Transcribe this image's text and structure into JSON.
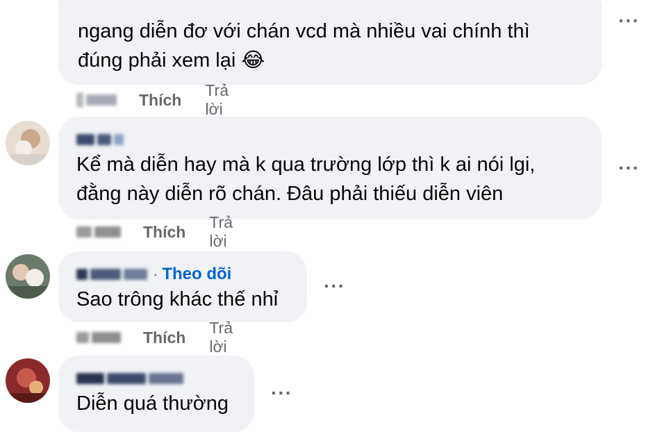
{
  "comments": [
    {
      "text": "ngang diễn đơ với chán vcd mà nhiều vai chính thì\nđúng phải xem lại",
      "emoji": "😂",
      "like_label": "Thích",
      "reply_label": "Trả lời",
      "more_label": "···"
    },
    {
      "text": "Kể mà diễn hay mà k qua trường lớp thì k ai nói lgi,\nđằng này diễn rõ chán. Đâu phải thiếu diễn viên",
      "like_label": "Thích",
      "reply_label": "Trả lời",
      "more_label": "···"
    },
    {
      "follow_label": "Theo dõi",
      "text": "Sao trông khác thế nhỉ",
      "like_label": "Thích",
      "reply_label": "Trả lời",
      "more_label": "···"
    },
    {
      "text": "Diễn quá thường",
      "more_label": "···"
    }
  ],
  "colors": {
    "bubble": "#f0f2f5",
    "muted": "#65676b",
    "link": "#0064d1",
    "text": "#050505"
  }
}
